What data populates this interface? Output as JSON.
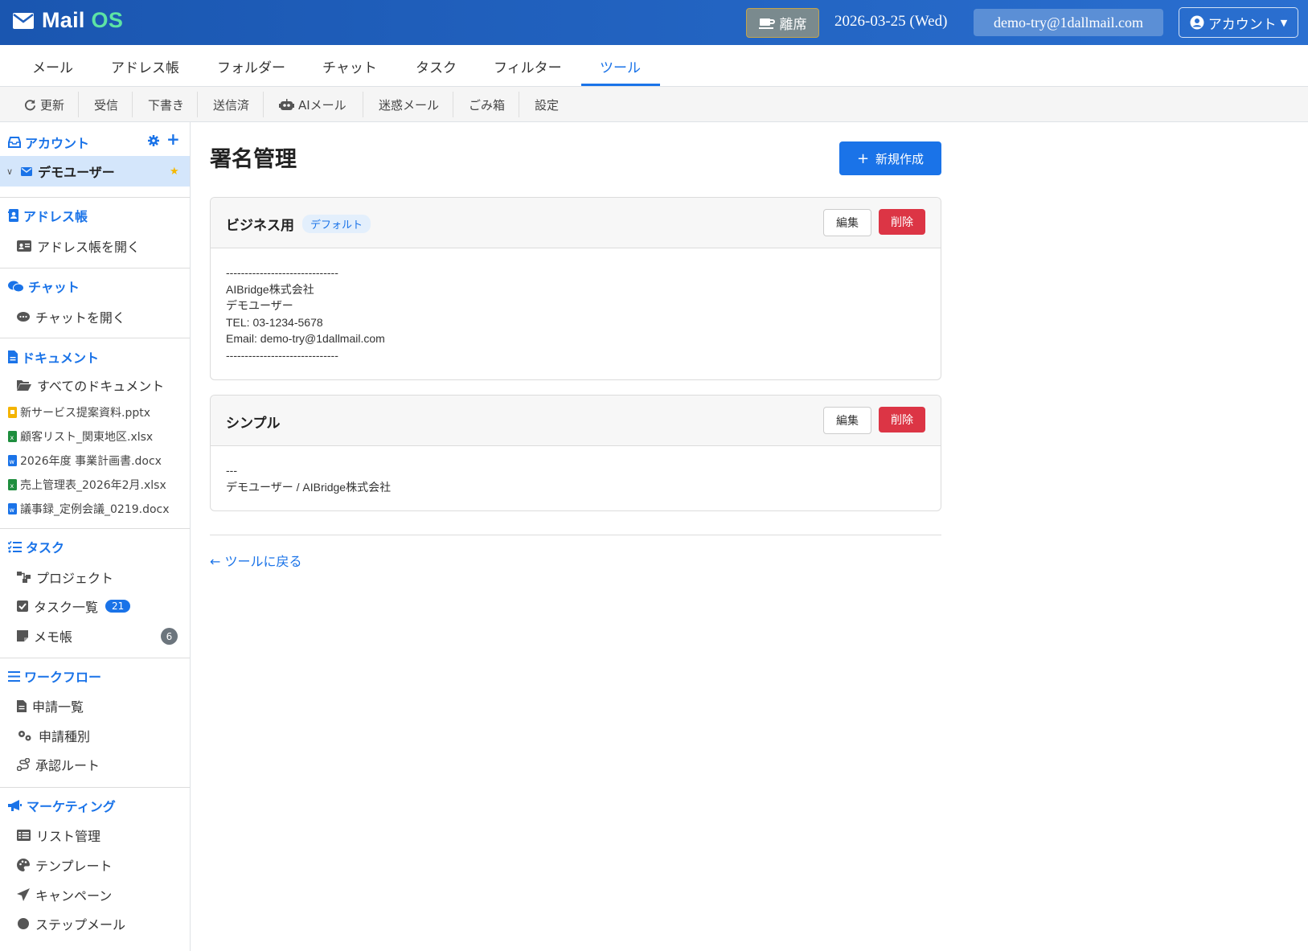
{
  "header": {
    "brand_main": "Mail",
    "brand_accent": "OS",
    "away_label": "離席",
    "date": "2026-03-25 (Wed)",
    "email": "demo-try@1dallmail.com",
    "account_label": "アカウント"
  },
  "tabs": [
    {
      "label": "メール"
    },
    {
      "label": "アドレス帳"
    },
    {
      "label": "フォルダー"
    },
    {
      "label": "チャット"
    },
    {
      "label": "タスク"
    },
    {
      "label": "フィルター"
    },
    {
      "label": "ツール",
      "active": true
    }
  ],
  "subbar": [
    {
      "label": "更新",
      "icon": "refresh-icon"
    },
    {
      "label": "受信"
    },
    {
      "label": "下書き"
    },
    {
      "label": "送信済"
    },
    {
      "label": "AIメール",
      "icon": "robot-icon"
    },
    {
      "label": "迷惑メール"
    },
    {
      "label": "ごみ箱"
    },
    {
      "label": "設定"
    }
  ],
  "sidebar": {
    "accounts": {
      "title": "アカウント",
      "user": "デモユーザー"
    },
    "addressbook": {
      "title": "アドレス帳",
      "open": "アドレス帳を開く"
    },
    "chat": {
      "title": "チャット",
      "open": "チャットを開く"
    },
    "documents": {
      "title": "ドキュメント",
      "all": "すべてのドキュメント",
      "files": [
        {
          "name": "新サービス提案資料.pptx",
          "type": "pptx"
        },
        {
          "name": "顧客リスト_関東地区.xlsx",
          "type": "xlsx"
        },
        {
          "name": "2026年度 事業計画書.docx",
          "type": "docx"
        },
        {
          "name": "売上管理表_2026年2月.xlsx",
          "type": "xlsx"
        },
        {
          "name": "議事録_定例会議_0219.docx",
          "type": "docx"
        }
      ]
    },
    "tasks": {
      "title": "タスク",
      "project": "プロジェクト",
      "task_list": "タスク一覧",
      "task_count": "21",
      "memo": "メモ帳",
      "memo_count": "6"
    },
    "workflow": {
      "title": "ワークフロー",
      "requests": "申請一覧",
      "types": "申請種別",
      "routes": "承認ルート"
    },
    "marketing": {
      "title": "マーケティング",
      "lists": "リスト管理",
      "templates": "テンプレート",
      "campaigns": "キャンペーン",
      "step": "ステップメール"
    }
  },
  "main": {
    "title": "署名管理",
    "new_button": "新規作成",
    "edit_label": "編集",
    "delete_label": "削除",
    "signatures": [
      {
        "name": "ビジネス用",
        "badge": "デフォルト",
        "body": "------------------------------\nAIBridge株式会社\nデモユーザー\nTEL: 03-1234-5678\nEmail: demo-try@1dallmail.com\n------------------------------"
      },
      {
        "name": "シンプル",
        "body": "---\nデモユーザー / AIBridge株式会社"
      }
    ],
    "back_link": "← ツールに戻る"
  },
  "colors": {
    "primary": "#1a73e8",
    "danger": "#dc3545",
    "header": "#1a56b0",
    "brand_accent": "#5de3a4"
  }
}
